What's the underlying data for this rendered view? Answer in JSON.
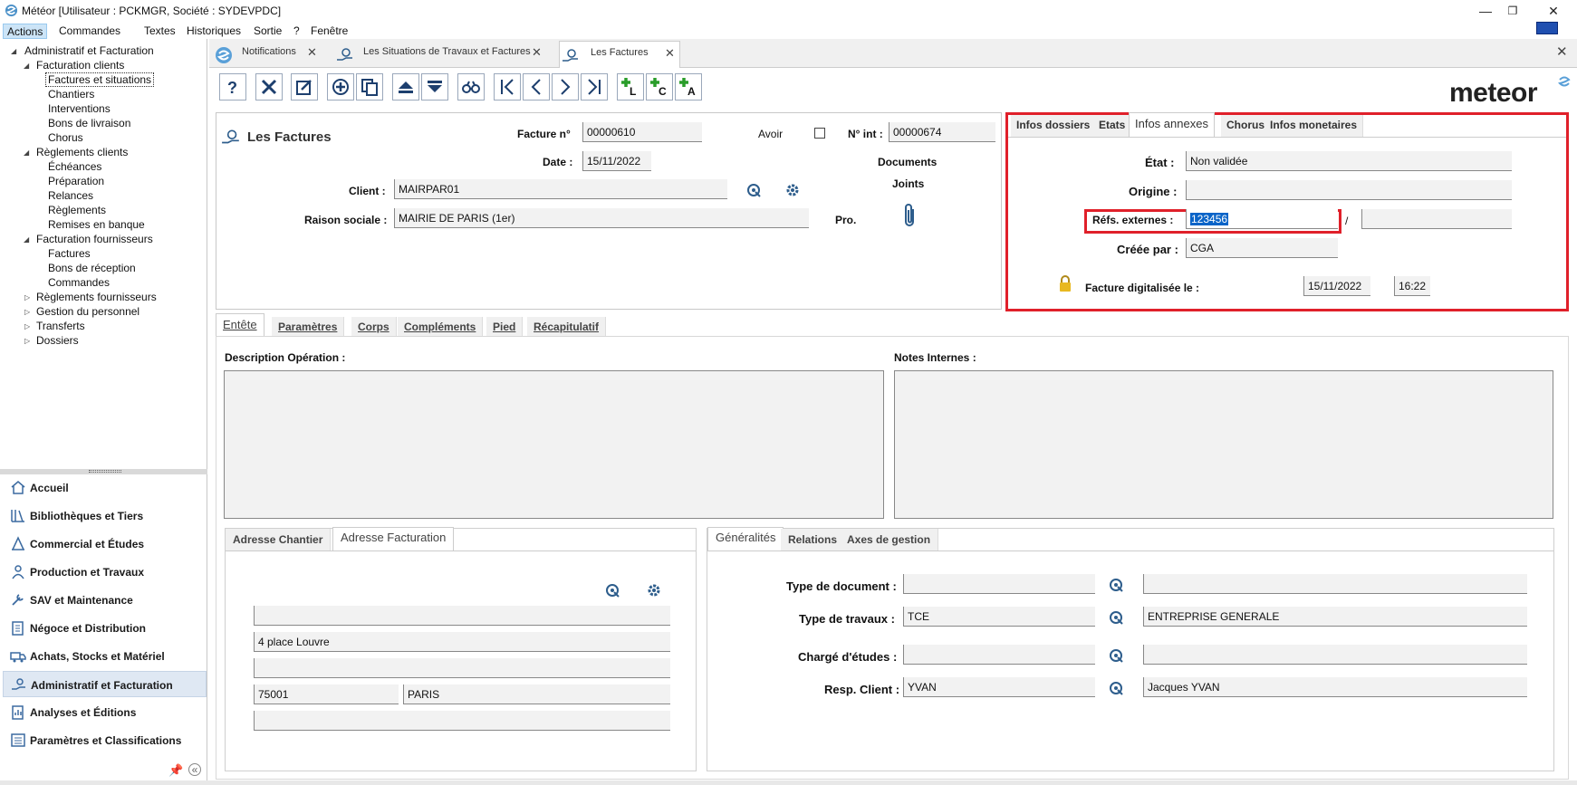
{
  "window": {
    "title": "Météor [Utilisateur : PCKMGR, Société : SYDEVPDC]",
    "minimize": "—",
    "restore": "❐",
    "close": "✕"
  },
  "menu": [
    "Actions",
    "Commandes",
    "Textes",
    "Historiques",
    "Sortie",
    "?",
    "Fenêtre"
  ],
  "tree": {
    "root": "Administratif et Facturation",
    "facturation_clients": "Facturation clients",
    "fc_items": [
      "Factures et situations",
      "Chantiers",
      "Interventions",
      "Bons de livraison",
      "Chorus"
    ],
    "reglements_clients": "Règlements clients",
    "rc_items": [
      "Échéances",
      "Préparation",
      "Relances",
      "Règlements",
      "Remises en banque"
    ],
    "facturation_fournisseurs": "Facturation fournisseurs",
    "ff_items": [
      "Factures",
      "Bons de réception",
      "Commandes"
    ],
    "others": [
      "Règlements fournisseurs",
      "Gestion du personnel",
      "Transferts",
      "Dossiers"
    ]
  },
  "nav": [
    "Accueil",
    "Bibliothèques et Tiers",
    "Commercial et Études",
    "Production et Travaux",
    "SAV et Maintenance",
    "Négoce et Distribution",
    "Achats, Stocks et Matériel",
    "Administratif et Facturation",
    "Analyses et Éditions",
    "Paramètres et Classifications"
  ],
  "doc_tabs": [
    "Notifications",
    "Les Situations de Travaux et Factures",
    "Les Factures"
  ],
  "brand": "meteor",
  "header": {
    "title": "Les Factures",
    "facture_label": "Facture n°",
    "facture_value": "00000610",
    "avoir_label": "Avoir",
    "nint_label": "N° int :",
    "nint_value": "00000674",
    "date_label": "Date :",
    "date_value": "15/11/2022",
    "docs_label1": "Documents",
    "docs_label2": "Joints",
    "client_label": "Client :",
    "client_value": "MAIRPAR01",
    "raison_label": "Raison sociale :",
    "raison_value": "MAIRIE DE PARIS (1er)",
    "pro_label": "Pro."
  },
  "annexes": {
    "tabs": [
      "Infos dossiers",
      "Etats",
      "Infos annexes",
      "Chorus",
      "Infos monetaires"
    ],
    "etat_label": "État :",
    "etat_value": "Non validée",
    "origine_label": "Origine :",
    "origine_value": "",
    "refs_label": "Réfs. externes :",
    "refs_value": "123456",
    "slash": "/",
    "creee_label": "Créée par :",
    "creee_value": "CGA",
    "digit_label": "Facture digitalisée le :",
    "digit_date": "15/11/2022",
    "digit_time": "16:22"
  },
  "subtabs": [
    "Entête",
    "Paramètres",
    "Corps",
    "Compléments",
    "Pied",
    "Récapitulatif"
  ],
  "entete": {
    "desc_label": "Description Opération :",
    "notes_label": "Notes Internes :"
  },
  "address": {
    "tabs": [
      "Adresse Chantier",
      "Adresse Facturation"
    ],
    "line1": "",
    "line2": "4 place Louvre",
    "line3": "",
    "cp": "75001",
    "ville": "PARIS",
    "line5": ""
  },
  "general": {
    "tabs": [
      "Généralités",
      "Relations",
      "Axes de gestion"
    ],
    "type_doc_label": "Type de document :",
    "type_doc_code": "",
    "type_doc_desc": "",
    "type_trav_label": "Type de travaux :",
    "type_trav_code": "TCE",
    "type_trav_desc": "ENTREPRISE GENERALE",
    "charge_label": "Chargé d'études :",
    "charge_code": "",
    "charge_desc": "",
    "resp_label": "Resp. Client :",
    "resp_code": "YVAN",
    "resp_desc": "Jacques YVAN"
  }
}
